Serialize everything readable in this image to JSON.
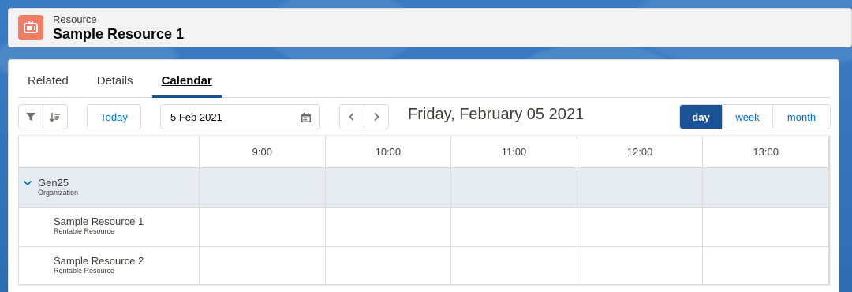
{
  "header": {
    "object_type": "Resource",
    "record_name": "Sample Resource 1",
    "icon": "tv-icon"
  },
  "tabs": [
    {
      "label": "Related",
      "active": false
    },
    {
      "label": "Details",
      "active": false
    },
    {
      "label": "Calendar",
      "active": true
    }
  ],
  "toolbar": {
    "filter_icon": "filter-icon",
    "sort_icon": "sort-icon",
    "today_label": "Today",
    "date_value": "5 Feb 2021",
    "calendar_icon": "calendar-icon",
    "prev_icon": "chevron-left-icon",
    "next_icon": "chevron-right-icon",
    "current_date": "Friday, February 05 2021",
    "views": [
      "day",
      "week",
      "month"
    ],
    "active_view": "day"
  },
  "schedule": {
    "hours": [
      "9:00",
      "10:00",
      "11:00",
      "12:00",
      "13:00"
    ],
    "group": {
      "name": "Gen25",
      "type": "Organization"
    },
    "resources": [
      {
        "name": "Sample Resource 1",
        "type": "Rentable Resource"
      },
      {
        "name": "Sample Resource 2",
        "type": "Rentable Resource"
      }
    ]
  },
  "colors": {
    "brand": "#1b5297",
    "link": "#0070d2",
    "record_icon_bg": "#ef7e64",
    "group_row_bg": "#e6ebf2"
  }
}
